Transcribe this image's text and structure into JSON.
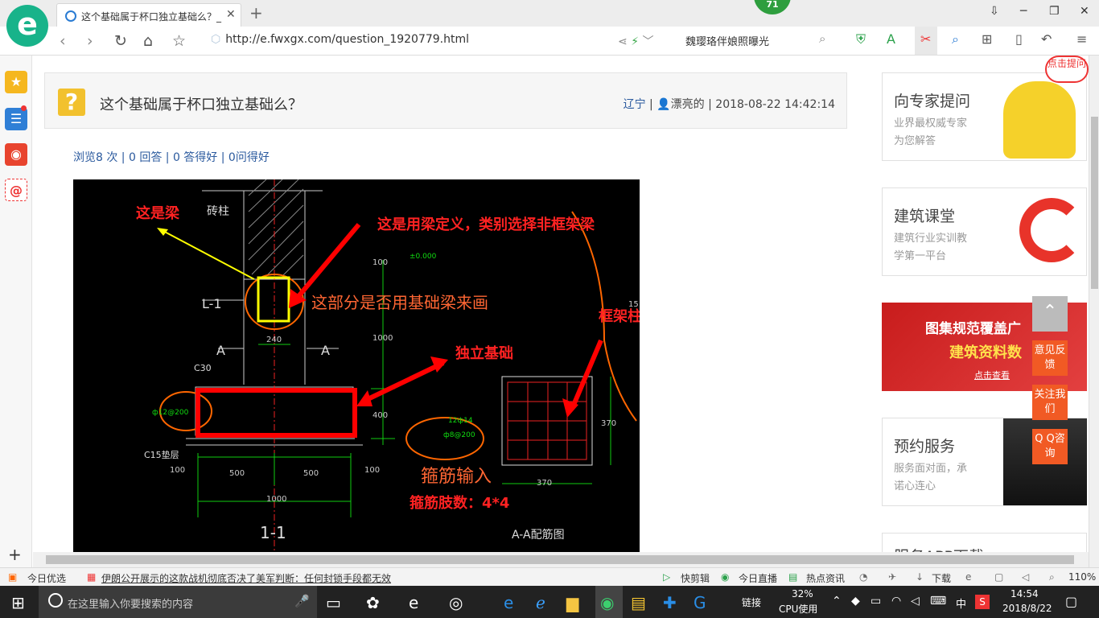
{
  "tab": {
    "title": "这个基础属于杯口独立基础么？_",
    "close": "✕",
    "new_tab": "+"
  },
  "badge": "71",
  "window": {
    "min": "─",
    "max": "❐",
    "close": "✕",
    "skin": "⇩"
  },
  "nav": {
    "url_host": "http://e.fwxgx.com/question_1920779.html",
    "search_text": "魏璎珞伴娘照曝光"
  },
  "question": {
    "title": "这个基础属于杯口独立基础么？",
    "location": "辽宁",
    "user": "漂亮的",
    "datetime": "2018-08-22 14:42:14",
    "stats": "浏览8 次 | 0 回答 | 0 答得好 | 0问得好"
  },
  "cad_labels": {
    "beam": "这是梁",
    "beam_def": "这是用梁定义，类别选择非框架梁",
    "foundation_beam_q": "这部分是否用基础梁来画",
    "frame_col": "框架柱",
    "isolated": "独立基础",
    "stirrup": "箍筋输入",
    "stirrup_legs": "箍筋肢数：4*4",
    "brick": "砖柱",
    "l1": "L-1",
    "a_left": "A",
    "a_right": "A",
    "c30": "C30",
    "c15": "C15垫层",
    "rebar1": "ф12@200",
    "rebar2": "12ф14",
    "rebar3": "ф8@200",
    "d500a": "500",
    "d500b": "500",
    "d1000": "1000",
    "d100a": "100",
    "d100b": "100",
    "d240": "240",
    "d400": "400",
    "d1000v": "1000",
    "d370": "370",
    "d370v": "370",
    "d100v": "100",
    "d15": "15",
    "d0000": "±0.000",
    "sec11": "1-1",
    "sec_aa": "A-A配筋图"
  },
  "ads": [
    {
      "title": "向专家提问",
      "sub1": "业界最权威专家",
      "sub2": "为您解答"
    },
    {
      "title": "建筑课堂",
      "sub1": "建筑行业实训教",
      "sub2": "学第一平台"
    },
    {
      "banner1": "图集规范覆盖广",
      "banner2": "建筑资料数",
      "banner3": "点击查看"
    },
    {
      "title": "预约服务",
      "sub1": "服务面对面，承",
      "sub2": "诺心连心"
    },
    {
      "title": "服务APP下载"
    }
  ],
  "corner_tag": "点击提问",
  "float_buttons": [
    "意见反馈",
    "关注我们",
    "Q Q咨询"
  ],
  "status": {
    "left1": "今日优选",
    "news": "伊朗公开展示的这款战机彻底否决了美军判断：任何封锁手段都无效",
    "r1": "快剪辑",
    "r2": "今日直播",
    "r3": "热点资讯",
    "r4": "下载",
    "zoom": "110%"
  },
  "taskbar": {
    "search_placeholder": "在这里输入你要搜索的内容",
    "link": "链接",
    "cpu": "32%",
    "cpu_label": "CPU使用",
    "lang": "中",
    "time": "14:54",
    "date": "2018/8/22"
  }
}
